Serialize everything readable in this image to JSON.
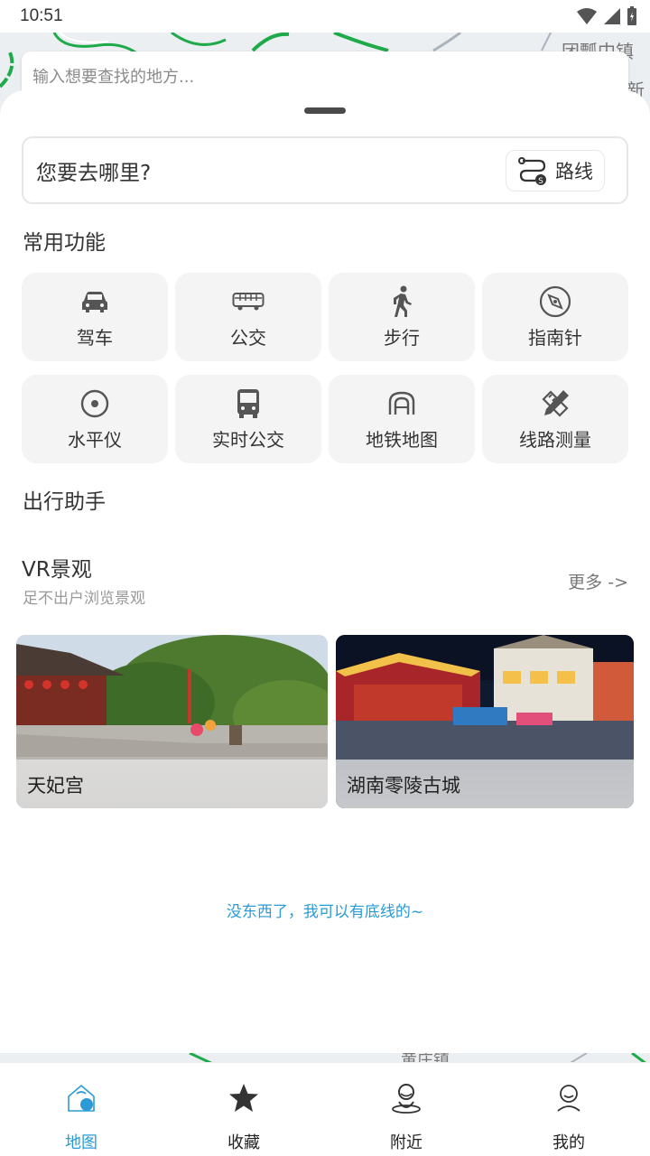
{
  "status_bar": {
    "time": "10:51"
  },
  "map": {
    "labels": [
      "团瓢中镇",
      "新店",
      "黄庄镇"
    ]
  },
  "search": {
    "placeholder": "输入想要查找的地方..."
  },
  "where": {
    "question": "您要去哪里?",
    "route_label": "路线"
  },
  "common": {
    "title": "常用功能",
    "items": [
      {
        "label": "驾车",
        "icon": "car-icon"
      },
      {
        "label": "公交",
        "icon": "bus-side-icon"
      },
      {
        "label": "步行",
        "icon": "walk-icon"
      },
      {
        "label": "指南针",
        "icon": "compass-icon"
      },
      {
        "label": "水平仪",
        "icon": "level-icon"
      },
      {
        "label": "实时公交",
        "icon": "bus-front-icon"
      },
      {
        "label": "地铁地图",
        "icon": "subway-icon"
      },
      {
        "label": "线路测量",
        "icon": "ruler-pencil-icon"
      }
    ]
  },
  "assistant": {
    "title": "出行助手"
  },
  "vr": {
    "title": "VR景观",
    "subtitle": "足不出户浏览景观",
    "more": "更多 ->",
    "cards": [
      {
        "label": "天妃宫"
      },
      {
        "label": "湖南零陵古城"
      }
    ]
  },
  "footer_note": "没东西了，我可以有底线的~",
  "tabs": [
    {
      "label": "地图",
      "icon": "map-home-icon",
      "active": true
    },
    {
      "label": "收藏",
      "icon": "star-icon",
      "active": false
    },
    {
      "label": "附近",
      "icon": "nearby-person-icon",
      "active": false
    },
    {
      "label": "我的",
      "icon": "profile-icon",
      "active": false
    }
  ],
  "colors": {
    "accent": "#2a9bd6",
    "tile_bg": "#f4f4f5",
    "map_road": "#1faa4a"
  }
}
